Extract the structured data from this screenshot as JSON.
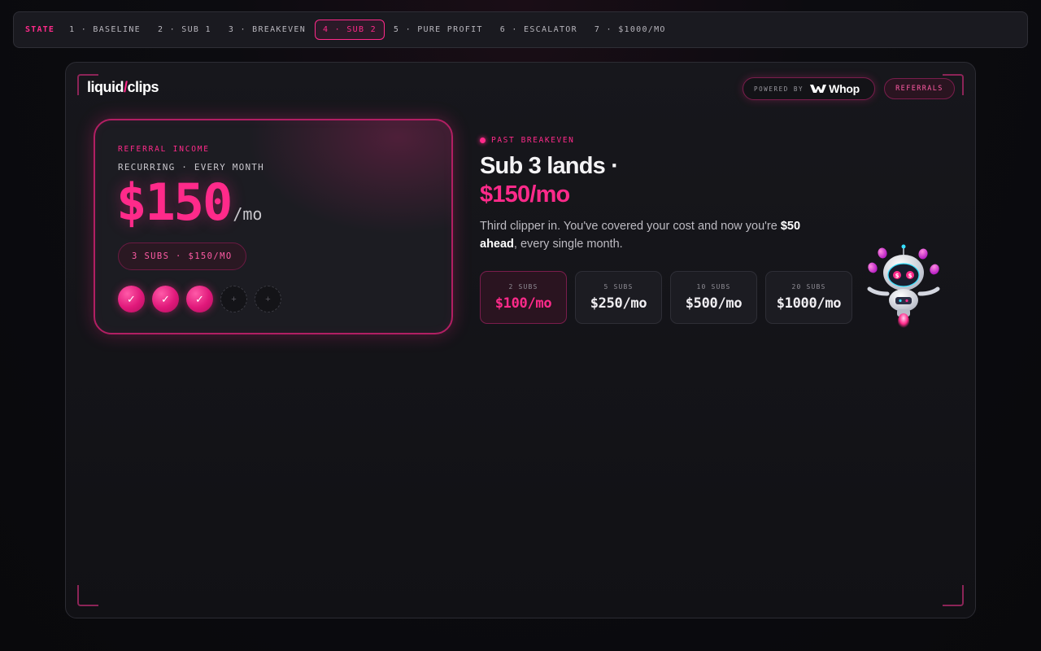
{
  "state_bar": {
    "label": "STATE",
    "items": [
      {
        "label": "1 · BASELINE",
        "active": false
      },
      {
        "label": "2 · SUB 1",
        "active": false
      },
      {
        "label": "3 · BREAKEVEN",
        "active": false
      },
      {
        "label": "4 · SUB 2",
        "active": true
      },
      {
        "label": "5 · PURE PROFIT",
        "active": false
      },
      {
        "label": "6 · ESCALATOR",
        "active": false
      },
      {
        "label": "7 · $1000/MO",
        "active": false
      }
    ]
  },
  "header": {
    "logo_left": "liquid",
    "logo_slash": "/",
    "logo_right": "clips",
    "powered_by": "POWERED BY",
    "partner": "Whop",
    "referrals_button": "REFERRALS"
  },
  "income_card": {
    "eyebrow": "REFERRAL INCOME",
    "subtitle": "RECURRING · EVERY MONTH",
    "amount": "$150",
    "unit": "/mo",
    "subs_pill": "3 SUBS · $150/MO",
    "filled_symbol": "✓",
    "empty_symbol": "+",
    "slots_filled": 3,
    "slots_total": 5
  },
  "milestone": {
    "status": "PAST BREAKEVEN",
    "headline": "Sub 3 lands ·",
    "headline_amount": "$150/mo",
    "desc_before": "Third clipper in. You've covered your cost and now you're ",
    "desc_bold": "$50 ahead",
    "desc_after": ", every single month."
  },
  "tiers": [
    {
      "label": "2 SUBS",
      "value": "$100/mo",
      "active": true
    },
    {
      "label": "5 SUBS",
      "value": "$250/mo",
      "active": false
    },
    {
      "label": "10 SUBS",
      "value": "$500/mo",
      "active": false
    },
    {
      "label": "20 SUBS",
      "value": "$1000/mo",
      "active": false
    }
  ],
  "colors": {
    "accent": "#ff2a8a",
    "background": "#0c0c10",
    "panel": "#17171c"
  }
}
